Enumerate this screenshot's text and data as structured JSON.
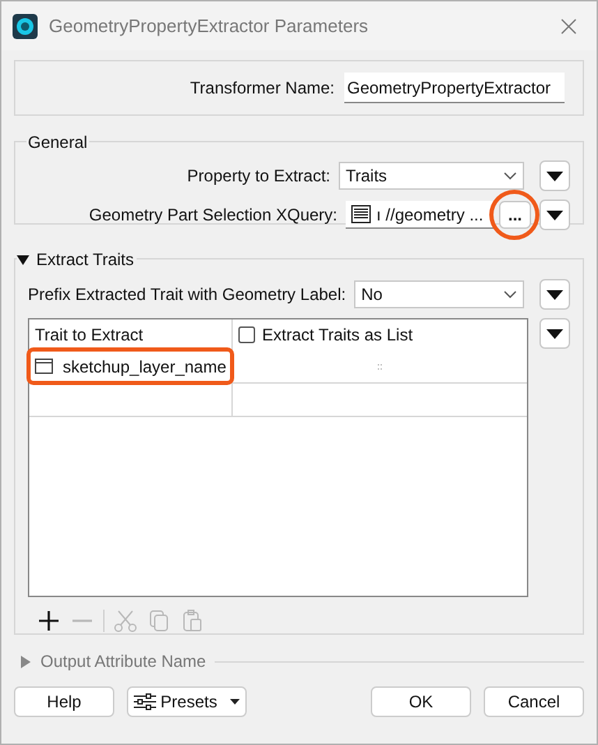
{
  "window": {
    "title": "GeometryPropertyExtractor Parameters"
  },
  "transformer_name": {
    "label": "Transformer Name:",
    "value": "GeometryPropertyExtractor"
  },
  "general": {
    "title": "General",
    "fields": [
      {
        "kind": "select",
        "label": "Property to Extract:",
        "value": "Traits",
        "highlighted": false
      },
      {
        "kind": "xquery",
        "label": "Geometry Part Selection XQuery:",
        "value": "ı //geometry ...",
        "button": "...",
        "highlighted": true
      }
    ]
  },
  "extract_traits": {
    "title": "Extract Traits",
    "expanded": true,
    "prefix": {
      "label": "Prefix Extracted Trait with Geometry Label:",
      "value": "No"
    },
    "table": {
      "columns": [
        {
          "kind": "text",
          "label": "Trait to Extract"
        },
        {
          "kind": "checkbox",
          "label": "Extract Traits as List",
          "checked": false
        }
      ],
      "rows": [
        {
          "value": "sketchup_layer_name",
          "highlighted": true
        }
      ]
    },
    "toolbar": [
      {
        "kind": "add",
        "disabled": false
      },
      {
        "kind": "remove",
        "disabled": true
      },
      {
        "kind": "cut",
        "disabled": true
      },
      {
        "kind": "copy",
        "disabled": true
      },
      {
        "kind": "paste",
        "disabled": true
      }
    ]
  },
  "output_attribute": {
    "title": "Output Attribute Name",
    "expanded": false
  },
  "buttons": {
    "help": "Help",
    "presets": "Presets",
    "ok": "OK",
    "cancel": "Cancel"
  }
}
